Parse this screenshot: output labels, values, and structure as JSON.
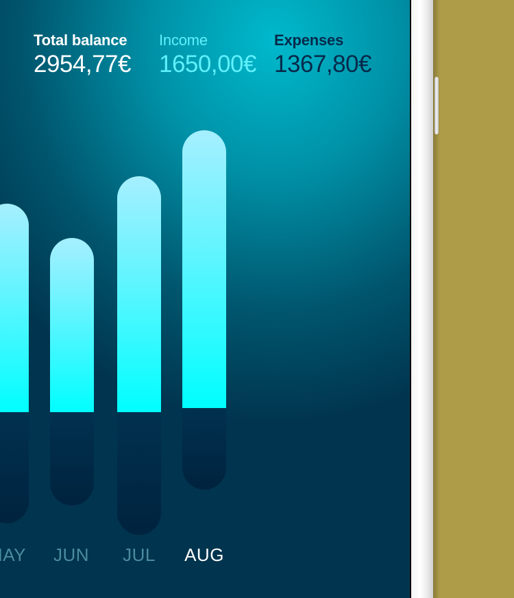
{
  "summary": {
    "total_label": "Total balance",
    "total_value": "2954,77€",
    "income_label": "Income",
    "income_value": "1650,00€",
    "expenses_label": "Expenses",
    "expenses_value": "1367,80€"
  },
  "colors": {
    "income_bar": "#00feff",
    "expense_bar": "#00233f",
    "income_text": "#5ff0fc",
    "expenses_text": "#062a4a",
    "month_inactive": "#4a8b9e",
    "month_active": "#ffffff"
  },
  "months": [
    "MAY",
    "JUN",
    "JUL",
    "AUG"
  ],
  "selected_month": "AUG"
}
